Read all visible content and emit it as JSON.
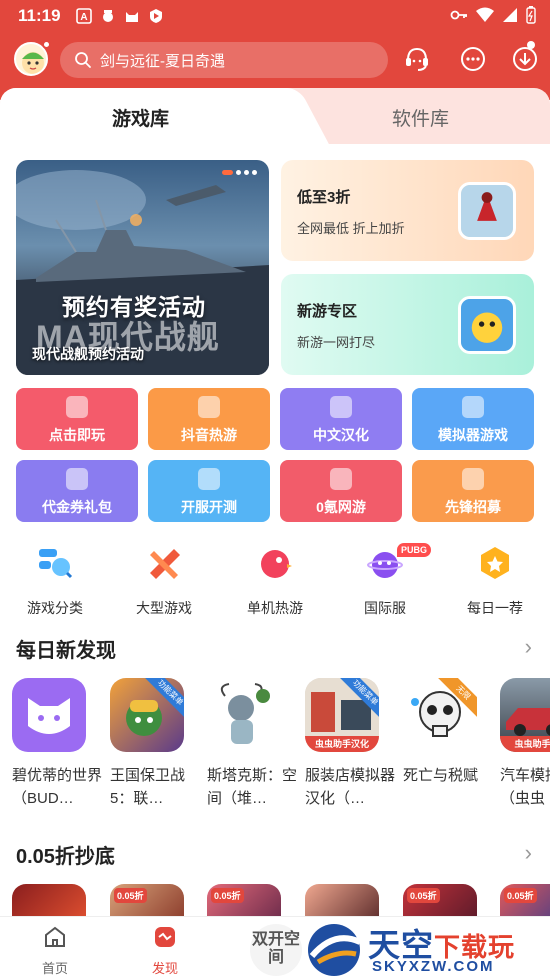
{
  "status_bar": {
    "time": "11:19"
  },
  "header": {
    "search_placeholder": "剑与远征-夏日奇遇"
  },
  "tabs": [
    {
      "label": "游戏库",
      "active": true
    },
    {
      "label": "软件库",
      "active": false
    }
  ],
  "banner": {
    "headline": "预约有奖活动",
    "logo_text": "MA现代战舰",
    "caption": "现代战舰预约活动"
  },
  "promos": [
    {
      "title": "低至3折",
      "subtitle": "全网最低 折上加折"
    },
    {
      "title": "新游专区",
      "subtitle": "新游一网打尽"
    }
  ],
  "tiles": [
    {
      "label": "点击即玩",
      "color": "#f45b6b"
    },
    {
      "label": "抖音热游",
      "color": "#fb9a47"
    },
    {
      "label": "中文汉化",
      "color": "#8f7df2"
    },
    {
      "label": "模拟器游戏",
      "color": "#5aa7f7"
    },
    {
      "label": "代金券礼包",
      "color": "#8a7cf0"
    },
    {
      "label": "开服开测",
      "color": "#55b4f5"
    },
    {
      "label": "0氪网游",
      "color": "#f25c6a"
    },
    {
      "label": "先锋招募",
      "color": "#fa9b4c"
    }
  ],
  "quick_icons": [
    {
      "label": "游戏分类",
      "icon": "category-icon"
    },
    {
      "label": "大型游戏",
      "icon": "large-game-icon"
    },
    {
      "label": "单机热游",
      "icon": "standalone-game-icon"
    },
    {
      "label": "国际服",
      "icon": "international-icon",
      "badge": "PUBG"
    },
    {
      "label": "每日一荐",
      "icon": "daily-pick-icon"
    }
  ],
  "section_daily": {
    "title": "每日新发现",
    "games": [
      {
        "name": "碧优蒂的世界（BUD…",
        "tag": "",
        "ribbon": ""
      },
      {
        "name": "王国保卫战5：联…",
        "tag": "",
        "ribbon": "功能菜单"
      },
      {
        "name": "斯塔克斯：空间（堆…",
        "tag": "",
        "ribbon": ""
      },
      {
        "name": "服装店模拟器汉化（…",
        "tag": "虫虫助手汉化",
        "ribbon": "功能菜单"
      },
      {
        "name": "死亡与税赋",
        "tag": "",
        "ribbon": "无限"
      },
      {
        "name": "汽车模拟化（虫虫",
        "tag": "虫虫助手汉",
        "ribbon": ""
      }
    ]
  },
  "section_discount": {
    "title": "0.05折抄底",
    "badges": [
      "",
      "0.05折",
      "0.05折",
      "",
      "0.05折",
      "0.05折"
    ]
  },
  "bottom_nav": [
    {
      "label": "首页",
      "active": false
    },
    {
      "label": "发现",
      "active": true
    }
  ],
  "dual_open": "双开空间",
  "watermark": {
    "cn_main": "天空",
    "cn_accent": "下载玩",
    "en": "SKYXZW.COM"
  },
  "colors": {
    "brand": "#e2473d"
  }
}
